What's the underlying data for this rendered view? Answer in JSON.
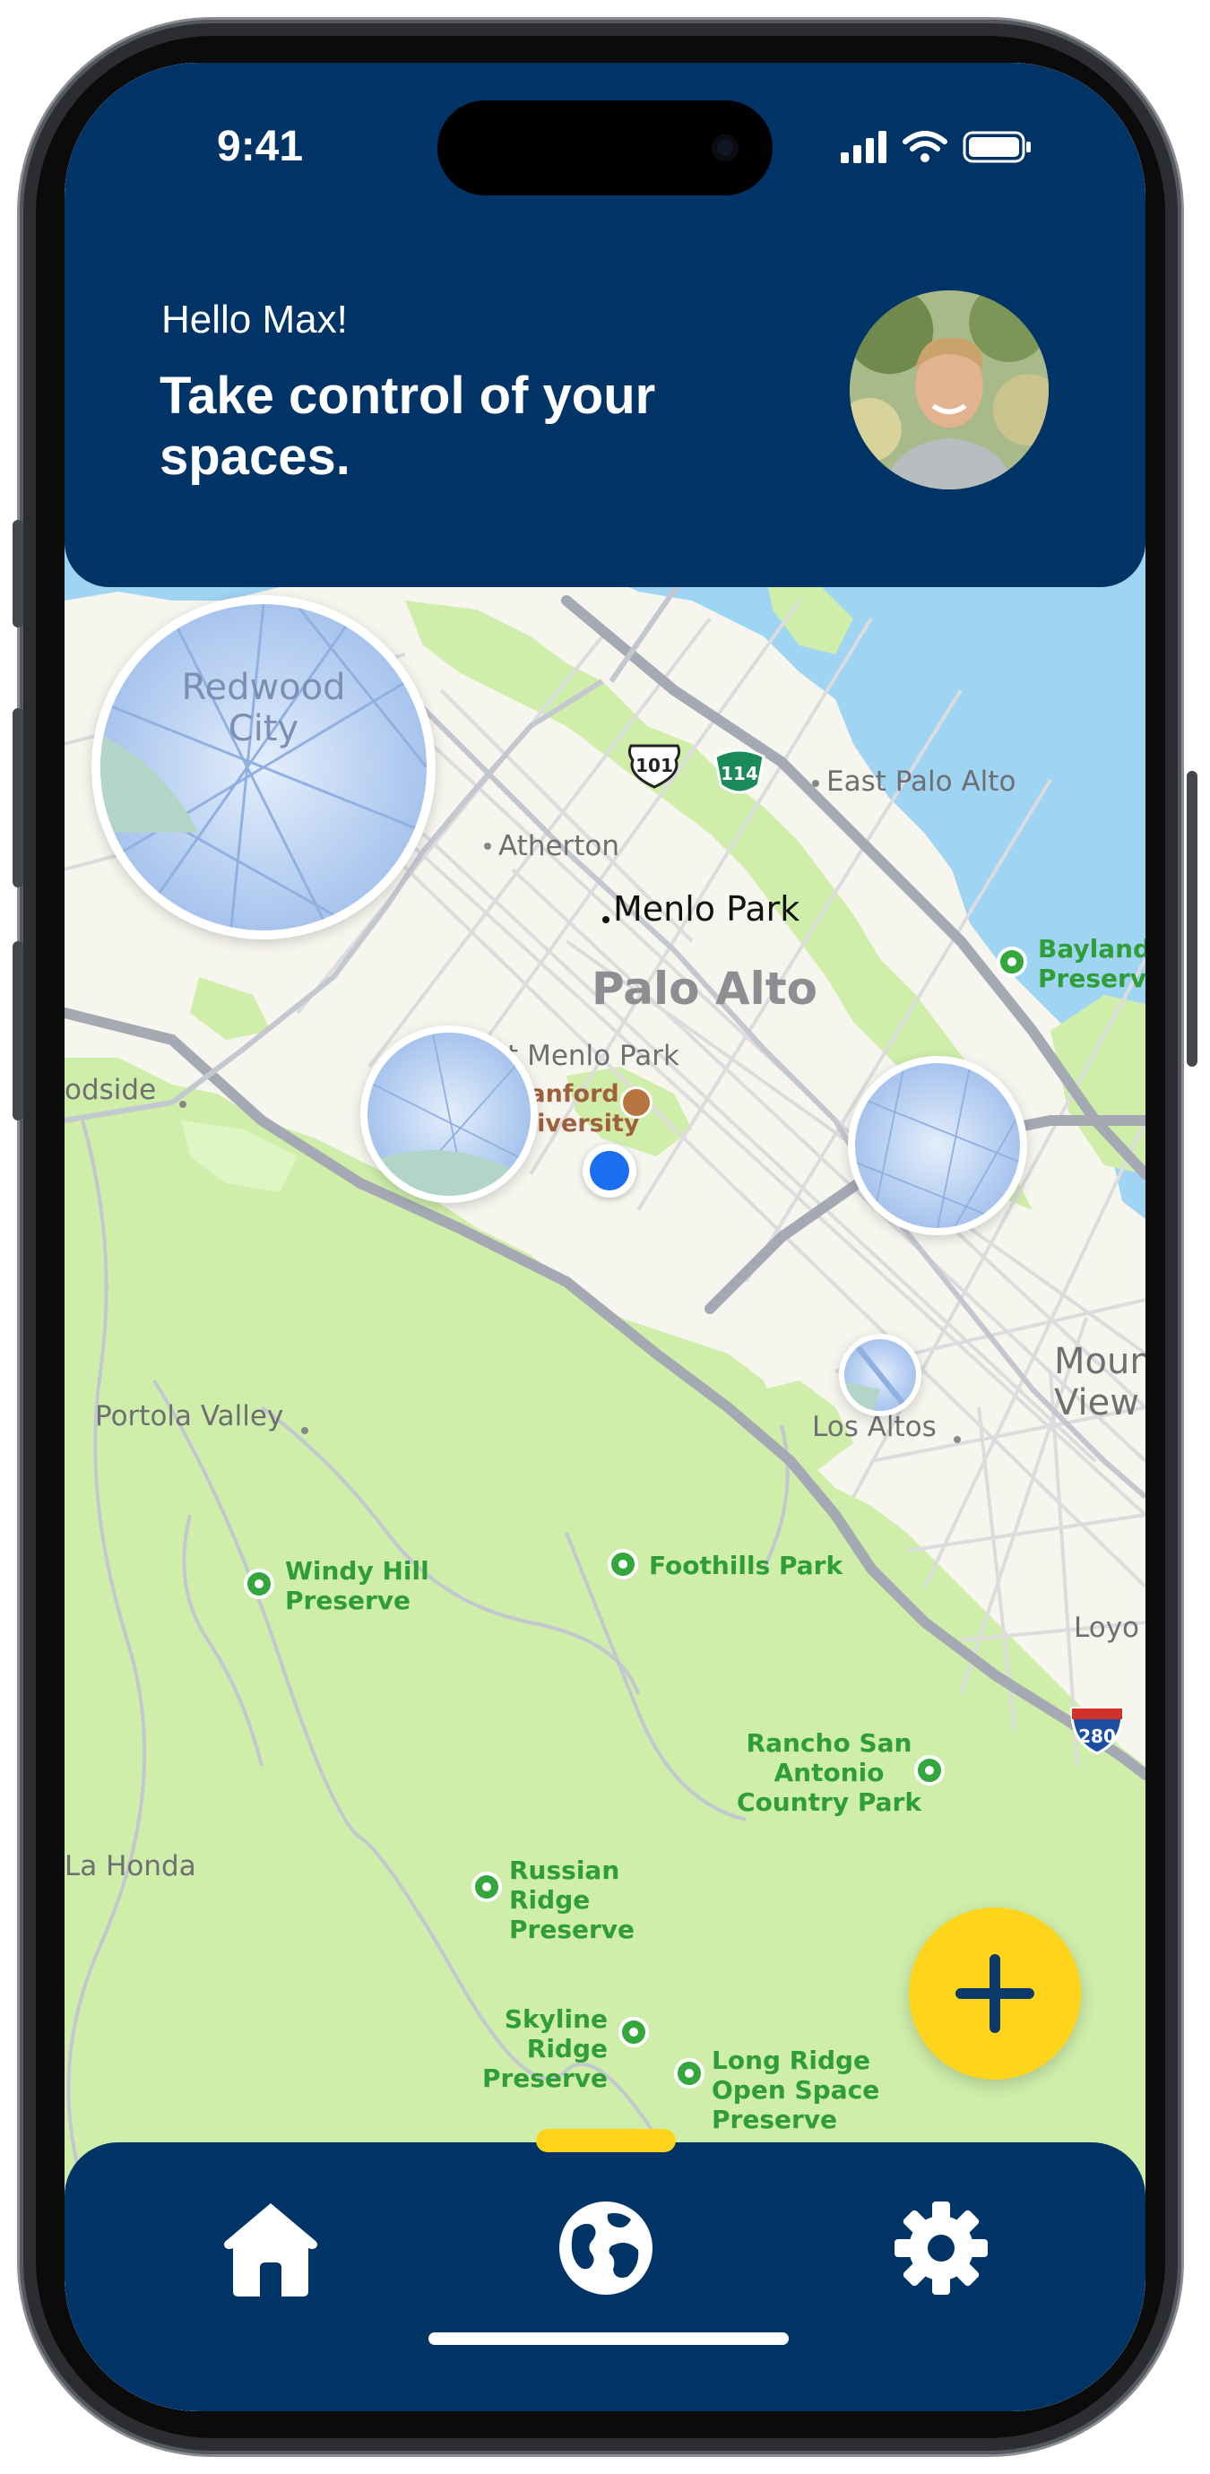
{
  "status_bar": {
    "time": "9:41"
  },
  "header": {
    "greeting": "Hello Max!",
    "headline": "Take control of your spaces."
  },
  "map": {
    "labels": {
      "redwood_city": "Redwood City",
      "atherton": "Atherton",
      "east_palo_alto": "East Palo Alto",
      "menlo_park": "Menlo Park",
      "palo_alto": "Palo Alto",
      "baylands": "Baylands Preserve",
      "woodside": "odside",
      "west_menlo_park": "West Menlo Park",
      "stanford": "Stanford University",
      "mountain_view": "Mountain View",
      "portola_valley": "Portola Valley",
      "los_altos": "Los Altos",
      "windy_hill": "Windy Hill Preserve",
      "foothills_park": "Foothills Park",
      "loyola": "Loyo",
      "rancho_san_antonio": "Rancho San Antonio Country Park",
      "la_honda": "La Honda",
      "russian_ridge": "Russian Ridge Preserve",
      "skyline_ridge": "Skyline Ridge Preserve",
      "long_ridge": "Long Ridge Open Space Preserve"
    },
    "shields": {
      "us101": "101",
      "ca114": "114",
      "i280": "280"
    },
    "colors": {
      "water": "#9fd4f2",
      "land": "#f7f6ee",
      "park": "#cfeeaa",
      "road": "#b9bcc6",
      "highway": "#9da1ac"
    }
  },
  "actions": {
    "add_space_icon": "plus-icon"
  },
  "nav": {
    "items": [
      {
        "name": "home",
        "icon": "home-icon"
      },
      {
        "name": "explore",
        "icon": "globe-icon"
      },
      {
        "name": "settings",
        "icon": "gear-icon"
      }
    ]
  },
  "colors": {
    "primary": "#003467",
    "accent": "#ffd51c",
    "location": "#1a6ef0"
  }
}
